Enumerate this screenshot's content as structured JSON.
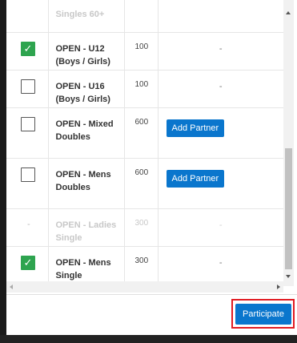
{
  "rows": [
    {
      "id": "top",
      "checked": null,
      "name": "Singles 60+",
      "price": "",
      "action": ""
    },
    {
      "id": "u12",
      "checked": true,
      "name": "OPEN - U12 (Boys / Girls)",
      "price": "100",
      "action": "-"
    },
    {
      "id": "u16",
      "checked": false,
      "name": "OPEN - U16 (Boys / Girls)",
      "price": "100",
      "action": "-"
    },
    {
      "id": "mixed",
      "checked": false,
      "name": "OPEN - Mixed Doubles",
      "price": "600",
      "action": "Add Partner"
    },
    {
      "id": "mens-doubles",
      "checked": false,
      "name": "OPEN - Mens Doubles",
      "price": "600",
      "action": "Add Partner"
    },
    {
      "id": "ladies-single",
      "checked": null,
      "name": "OPEN - Ladies Single",
      "price": "300",
      "action": "-",
      "check_dash": "-"
    },
    {
      "id": "mens-single",
      "checked": true,
      "name": "OPEN - Mens Single",
      "price": "300",
      "action": "-"
    }
  ],
  "participate_label": "Participate",
  "check_glyph": "✓",
  "colors": {
    "accent": "#0a76cd",
    "check": "#2ea44f",
    "highlight": "#e11b22"
  }
}
